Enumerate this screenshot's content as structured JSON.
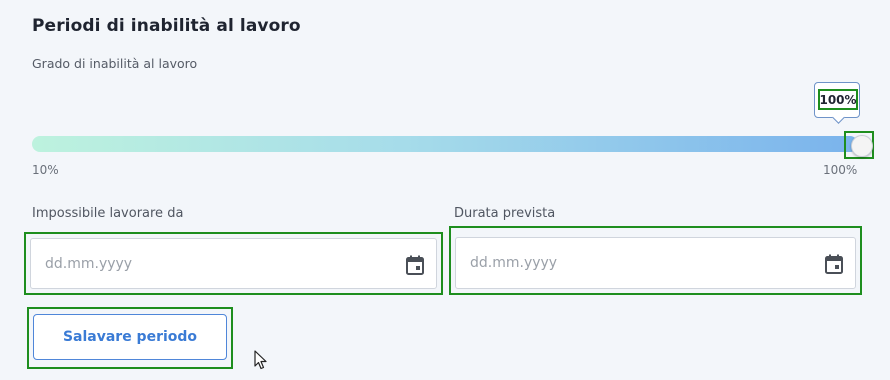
{
  "section": {
    "title": "Periodi di inabilità al lavoro"
  },
  "slider": {
    "label": "Grado di inabilità al lavoro",
    "value_label": "100%",
    "value_percent": 100,
    "min_label": "10%",
    "max_label": "100%",
    "colors": {
      "start": "#bdf2de",
      "end": "#7ab3ec"
    }
  },
  "fields": {
    "start": {
      "label": "Impossibile lavorare da",
      "placeholder": "dd.mm.yyyy",
      "icon": "calendar-icon"
    },
    "duration": {
      "label": "Durata prevista",
      "placeholder": "dd.mm.yyyy",
      "icon": "calendar-icon"
    }
  },
  "actions": {
    "save_label": "Salavare periodo"
  },
  "colors": {
    "accent": "#3a7bd5",
    "highlight": "#1e8e1e",
    "background": "#f3f6fa"
  }
}
